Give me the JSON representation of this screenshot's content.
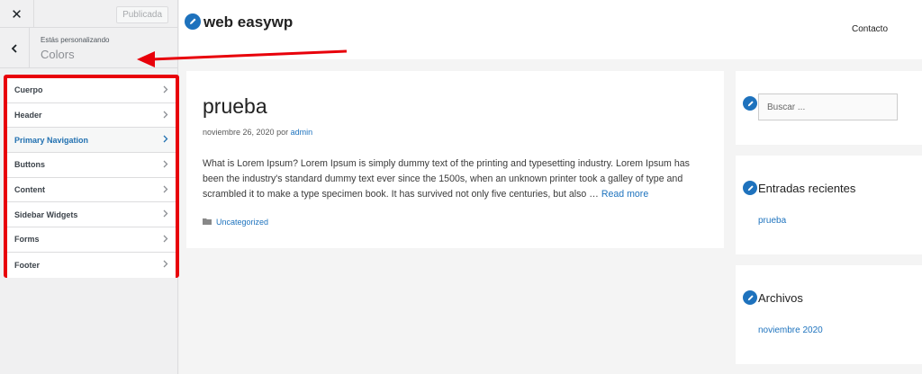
{
  "customizer": {
    "close_label": "✕",
    "publish_label": "Publicada",
    "breadcrumb": "Estás personalizando",
    "section_title": "Colors",
    "items": [
      {
        "label": "Cuerpo"
      },
      {
        "label": "Header"
      },
      {
        "label": "Primary Navigation"
      },
      {
        "label": "Buttons"
      },
      {
        "label": "Content"
      },
      {
        "label": "Sidebar Widgets"
      },
      {
        "label": "Forms"
      },
      {
        "label": "Footer"
      }
    ]
  },
  "site": {
    "title": "web easywp",
    "nav_link": "Contacto"
  },
  "post": {
    "title": "prueba",
    "date": "noviembre 26, 2020",
    "by": "por",
    "author": "admin",
    "excerpt": "What is Lorem Ipsum? Lorem Ipsum is simply dummy text of the printing and typesetting industry. Lorem Ipsum has been the industry's standard dummy text ever since the 1500s, when an unknown printer took a galley of type and scrambled it to make a type specimen book. It has survived not only five centuries, but also …",
    "read_more": "Read more",
    "category": "Uncategorized"
  },
  "sidebar": {
    "search_placeholder": "Buscar ...",
    "recent_title": "Entradas recientes",
    "recent_link": "prueba",
    "archives_title": "Archivos",
    "archives_link": "noviembre 2020"
  },
  "colors": {
    "highlight": "#e8000a",
    "link": "#1e73be"
  }
}
